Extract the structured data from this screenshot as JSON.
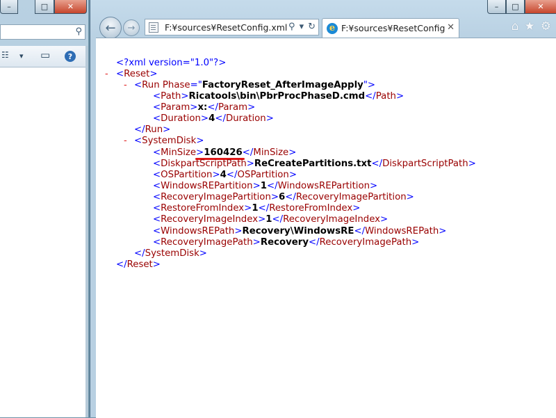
{
  "explorer_window": {
    "min_glyph": "–",
    "max_glyph": "□",
    "close_glyph": "✕",
    "search_icon": "magnifier-icon",
    "toolbar": {
      "view_glyph": "☷",
      "dropdown_glyph": "▾",
      "pane_glyph": "▭",
      "help_glyph": "?"
    }
  },
  "ie_window": {
    "controls": {
      "min_glyph": "–",
      "max_glyph": "□",
      "close_glyph": "✕"
    },
    "back_glyph": "←",
    "forward_glyph": "→",
    "address_url": "F:¥sources¥ResetConfig.xml",
    "address_icons": {
      "search": "⚲",
      "dropdown": "▾",
      "refresh": "↻"
    },
    "tab": {
      "title": "F:¥sources¥ResetConfig....",
      "close_glyph": "✕"
    },
    "toolbar": {
      "home": "⌂",
      "favorites": "★",
      "tools": "⚙"
    }
  },
  "xml": {
    "decl": "<?xml version=\"1.0\"?>",
    "collapse": "-",
    "reset": "Reset",
    "run": "Run",
    "phase_attr": "Phase",
    "phase_value": "FactoryReset_AfterImageApply",
    "path_tag": "Path",
    "path_value": "Ricatools\\bin\\PbrProcPhaseD.cmd",
    "param_tag": "Param",
    "param_value": "x:",
    "duration_tag": "Duration",
    "duration_value": "4",
    "systemdisk": "SystemDisk",
    "minsize_tag": "MinSize",
    "minsize_value": "160426",
    "diskpart_tag": "DiskpartScriptPath",
    "diskpart_value": "ReCreatePartitions.txt",
    "ospart_tag": "OSPartition",
    "ospart_value": "4",
    "winrepart_tag": "WindowsREPartition",
    "winrepart_value": "1",
    "recimgpart_tag": "RecoveryImagePartition",
    "recimgpart_value": "6",
    "restore_tag": "RestoreFromIndex",
    "restore_value": "1",
    "recimgidx_tag": "RecoveryImageIndex",
    "recimgidx_value": "1",
    "winrepath_tag": "WindowsREPath",
    "winrepath_value": "Recovery\\WindowsRE",
    "recimgpath_tag": "RecoveryImagePath",
    "recimgpath_value": "Recovery"
  },
  "highlight_color": "#e01818"
}
